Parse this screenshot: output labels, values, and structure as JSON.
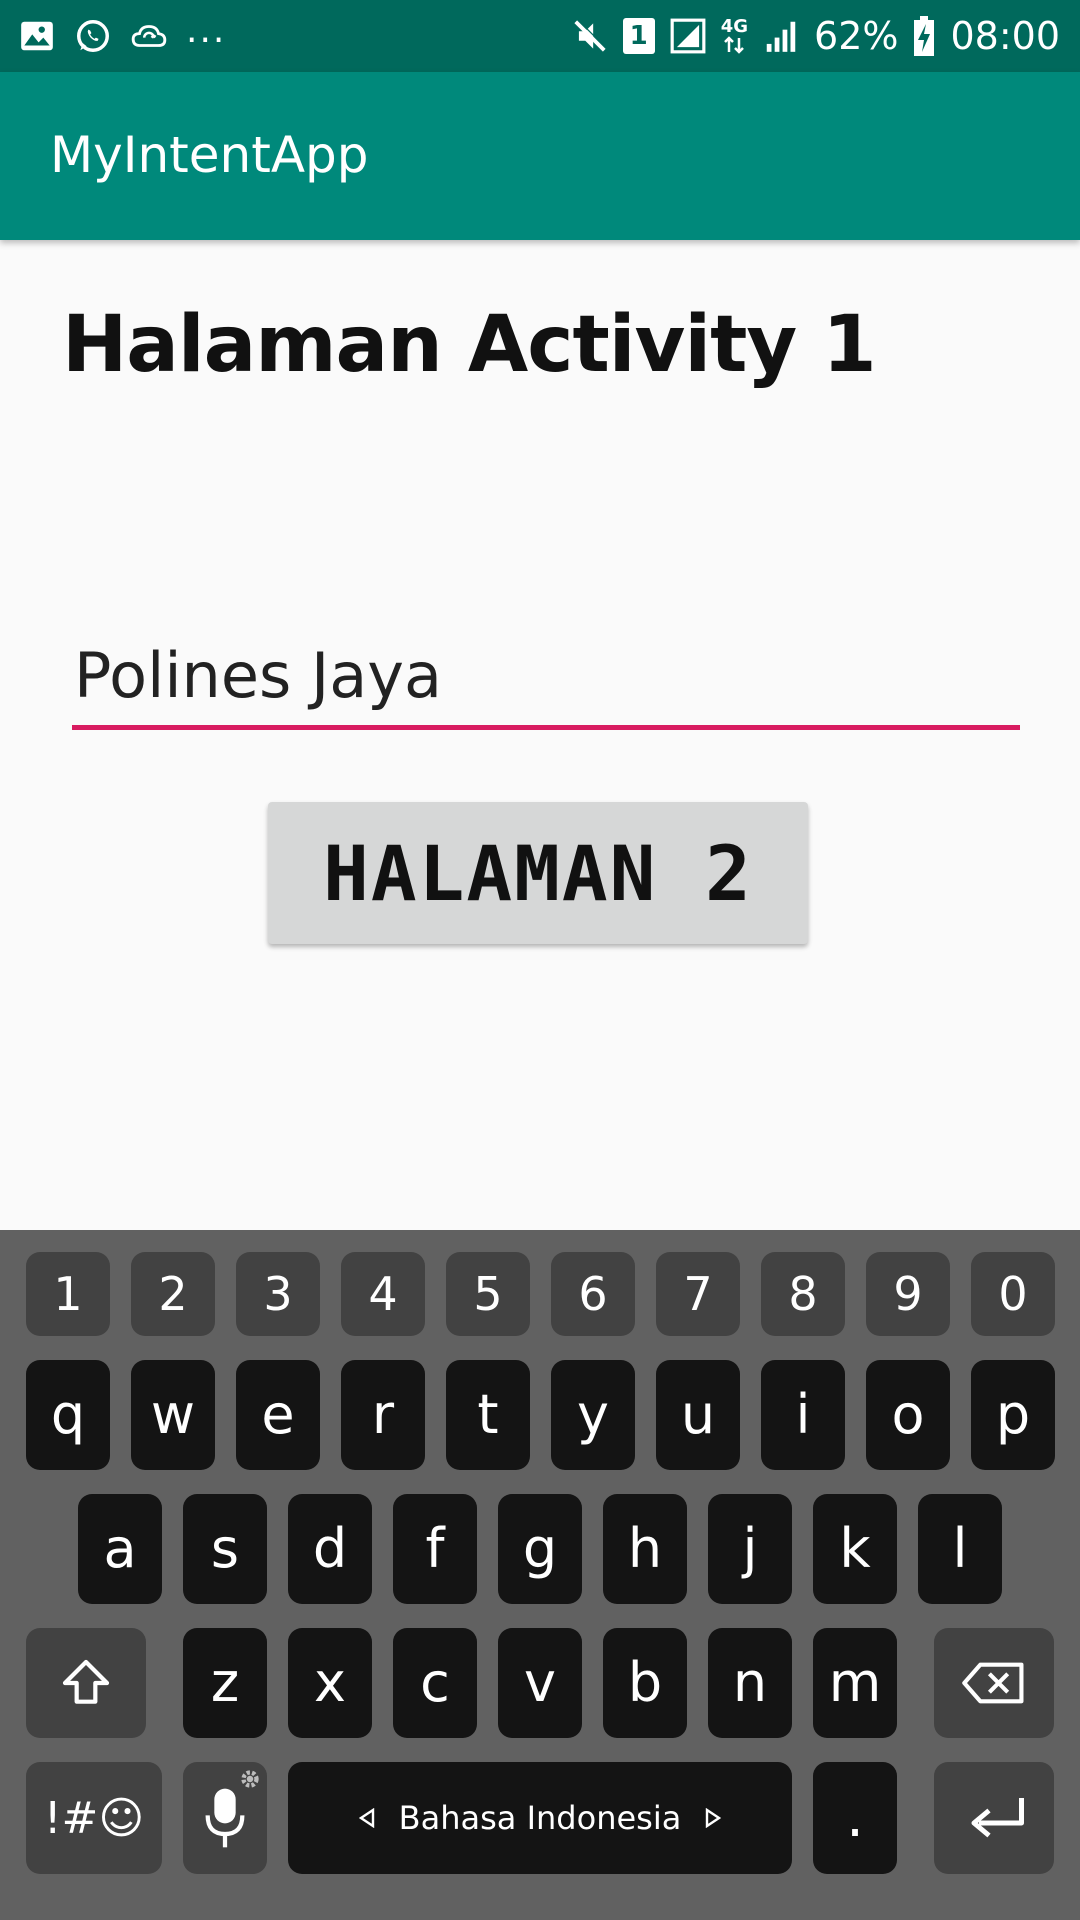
{
  "status_bar": {
    "left_icons": [
      "image-icon",
      "whatsapp-icon",
      "cloud-sync-icon"
    ],
    "overflow": "...",
    "sim_slot": "1",
    "network": "4G",
    "battery": "62%",
    "time": "08:00"
  },
  "app_bar": {
    "title": "MyIntentApp",
    "color": "#00897b",
    "status_color": "#00695c"
  },
  "main": {
    "heading": "Halaman Activity 1",
    "name_input": {
      "value": "Polines Jaya",
      "underline_color": "#d81b60"
    },
    "button_label": "HALAMAN 2"
  },
  "keyboard": {
    "number_row": [
      "1",
      "2",
      "3",
      "4",
      "5",
      "6",
      "7",
      "8",
      "9",
      "0"
    ],
    "row1": [
      "q",
      "w",
      "e",
      "r",
      "t",
      "y",
      "u",
      "i",
      "o",
      "p"
    ],
    "row2": [
      "a",
      "s",
      "d",
      "f",
      "g",
      "h",
      "j",
      "k",
      "l"
    ],
    "row3": [
      "z",
      "x",
      "c",
      "v",
      "b",
      "n",
      "m"
    ],
    "symbols_label": "!#☺",
    "space_label": "Bahasa Indonesia",
    "period_label": ".",
    "icons": {
      "shift": "shift-icon",
      "backspace": "backspace-icon",
      "mic": "mic-icon",
      "enter": "enter-icon"
    }
  }
}
